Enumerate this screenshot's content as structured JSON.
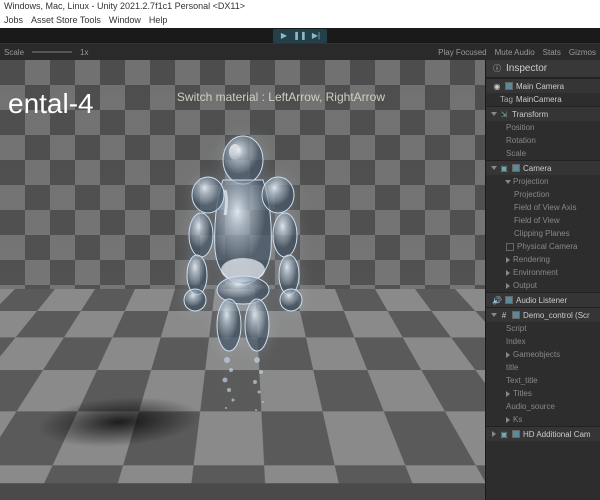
{
  "titlebar": "Windows, Mac, Linux - Unity 2021.2.7f1c1 Personal <DX11>",
  "menu": {
    "jobs": "Jobs",
    "assetstore": "Asset Store Tools",
    "window": "Window",
    "help": "Help"
  },
  "toolbar": {
    "scale": "Scale",
    "mult": "1x",
    "playfocused": "Play Focused",
    "mute": "Mute Audio",
    "stats": "Stats",
    "gizmos": "Gizmos"
  },
  "viewport": {
    "title": "ental-4",
    "hint": "Switch material : LeftArrow, RightArrow"
  },
  "inspector": {
    "header": "Inspector",
    "name": "Main Camera",
    "tag_label": "Tag",
    "tag_value": "MainCamera",
    "transform": {
      "label": "Transform",
      "position": "Position",
      "rotation": "Rotation",
      "scale": "Scale"
    },
    "camera": {
      "label": "Camera",
      "projection": "Projection",
      "proj": "Projection",
      "fov_axis": "Field of View Axis",
      "fov": "Field of View",
      "clip": "Clipping Planes",
      "physical": "Physical Camera"
    },
    "rendering": "Rendering",
    "environment": "Environment",
    "output": "Output",
    "audio": "Audio Listener",
    "demo": "Demo_control (Scr",
    "script": "Script",
    "index": "Index",
    "gameobjects": "Gameobjects",
    "title_f": "title",
    "text_title": "Text_title",
    "titles": "Titles",
    "audio_source": "Audio_source",
    "ks": "Ks",
    "hd": "HD Additional Cam"
  }
}
